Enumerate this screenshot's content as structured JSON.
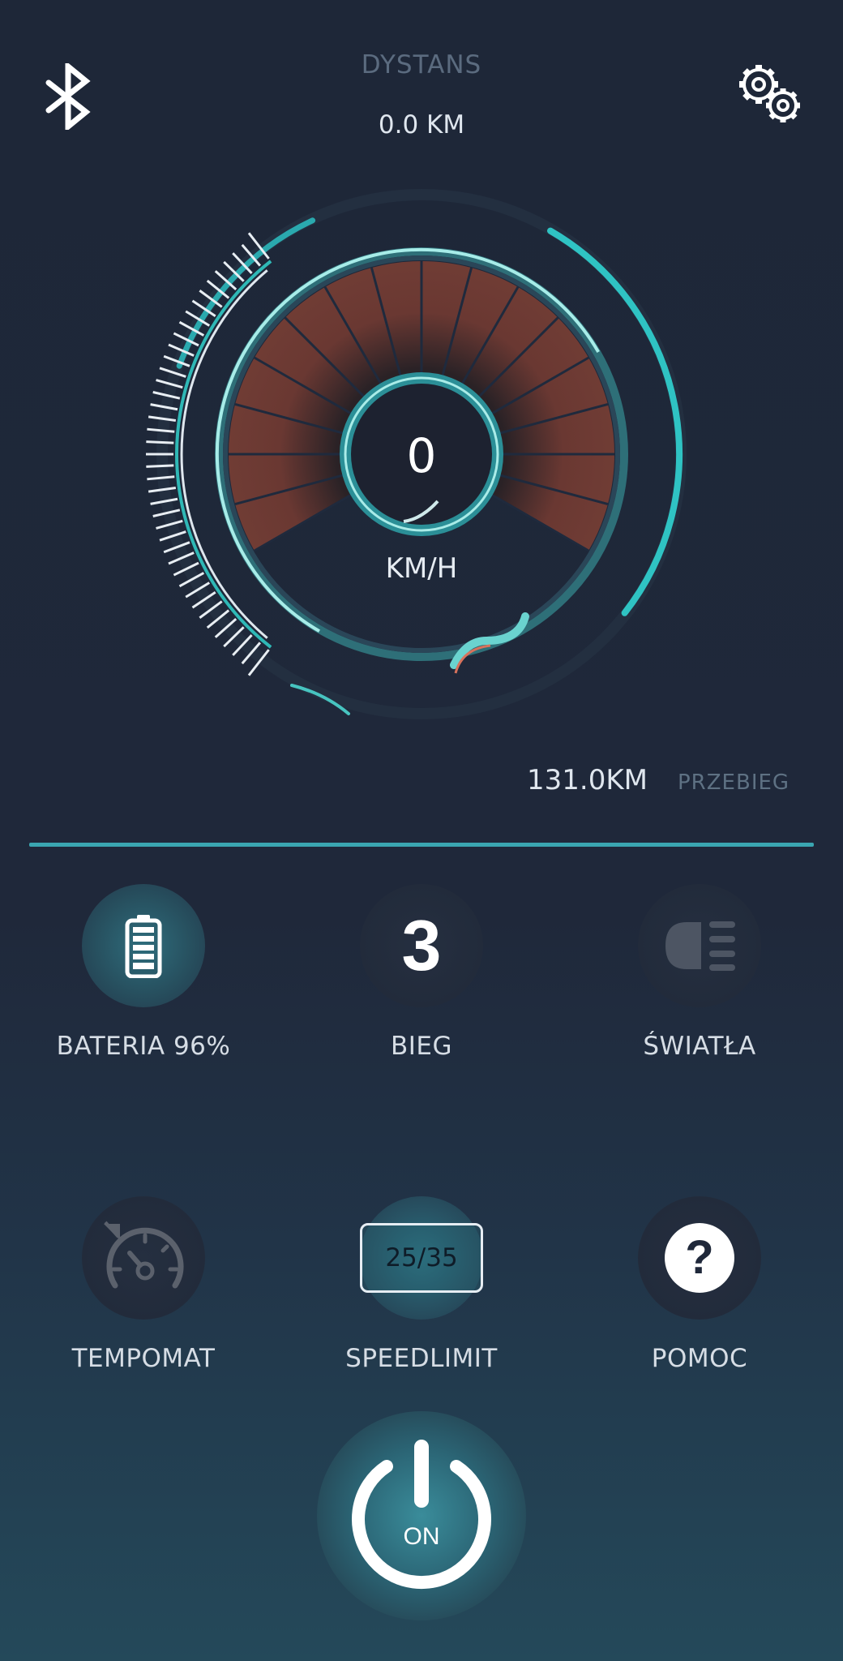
{
  "header": {
    "trip_label": "DYSTANS",
    "trip_value": "0.0 KM",
    "bluetooth_icon": "bluetooth-icon",
    "settings_icon": "gears-icon"
  },
  "speedometer": {
    "speed": "0",
    "unit": "KM/H"
  },
  "odometer": {
    "value": "131.0KM",
    "label": "PRZEBIEG"
  },
  "tiles": {
    "battery": {
      "label": "BATERIA 96%",
      "icon": "battery-icon",
      "level_percent": 96
    },
    "gear": {
      "value": "3",
      "label": "BIEG"
    },
    "lights": {
      "label": "ŚWIATŁA",
      "icon": "headlight-icon"
    },
    "cruise": {
      "label": "TEMPOMAT",
      "icon": "cruise-control-icon"
    },
    "speedlimit": {
      "value": "25/35",
      "label": "SPEEDLIMIT"
    },
    "help": {
      "label": "POMOC",
      "icon": "help-icon"
    }
  },
  "power": {
    "label": "ON",
    "icon": "power-icon"
  },
  "colors": {
    "accent": "#3aa6b1",
    "sector_fill": "#6e3a33",
    "background": "#1f283a"
  }
}
